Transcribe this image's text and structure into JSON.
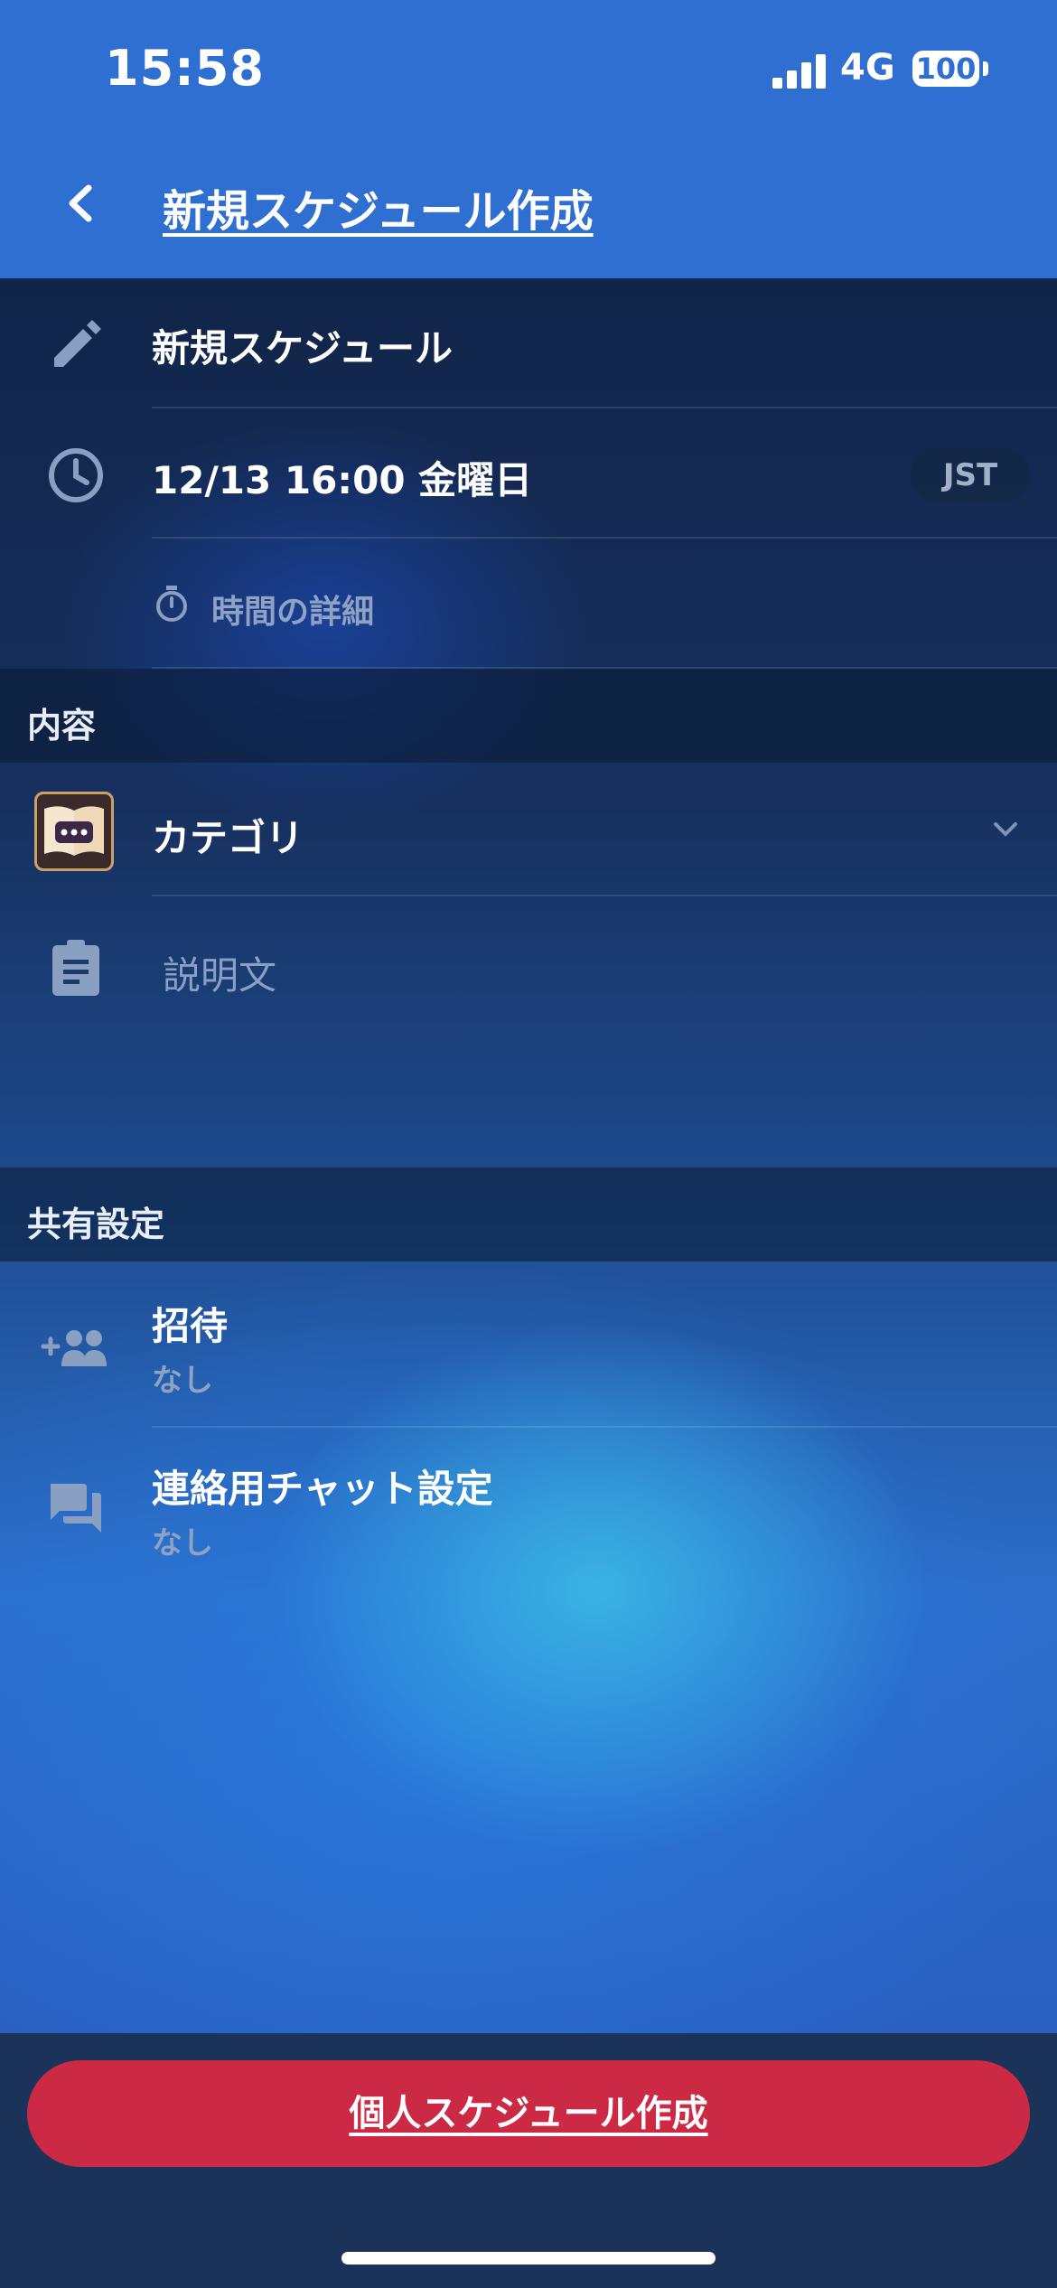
{
  "status_bar": {
    "time": "15:58",
    "network": "4G",
    "battery": "100"
  },
  "header": {
    "title": "新規スケジュール作成"
  },
  "schedule": {
    "title": "新規スケジュール",
    "datetime": "12/13 16:00 金曜日",
    "timezone": "JST",
    "time_detail_label": "時間の詳細"
  },
  "content_section": {
    "header": "内容",
    "category_label": "カテゴリ",
    "description_placeholder": "説明文"
  },
  "share_section": {
    "header": "共有設定",
    "invite": {
      "label": "招待",
      "value": "なし"
    },
    "chat": {
      "label": "連絡用チャット設定",
      "value": "なし"
    }
  },
  "cta": {
    "label": "個人スケジュール作成"
  },
  "colors": {
    "header_bg": "#2f6fd2",
    "cta_bg": "#cc2a44"
  },
  "icons": [
    "back-icon",
    "pencil-icon",
    "clock-icon",
    "stopwatch-icon",
    "category-book-icon",
    "chevron-down-icon",
    "clipboard-icon",
    "add-group-icon",
    "chat-icon"
  ]
}
